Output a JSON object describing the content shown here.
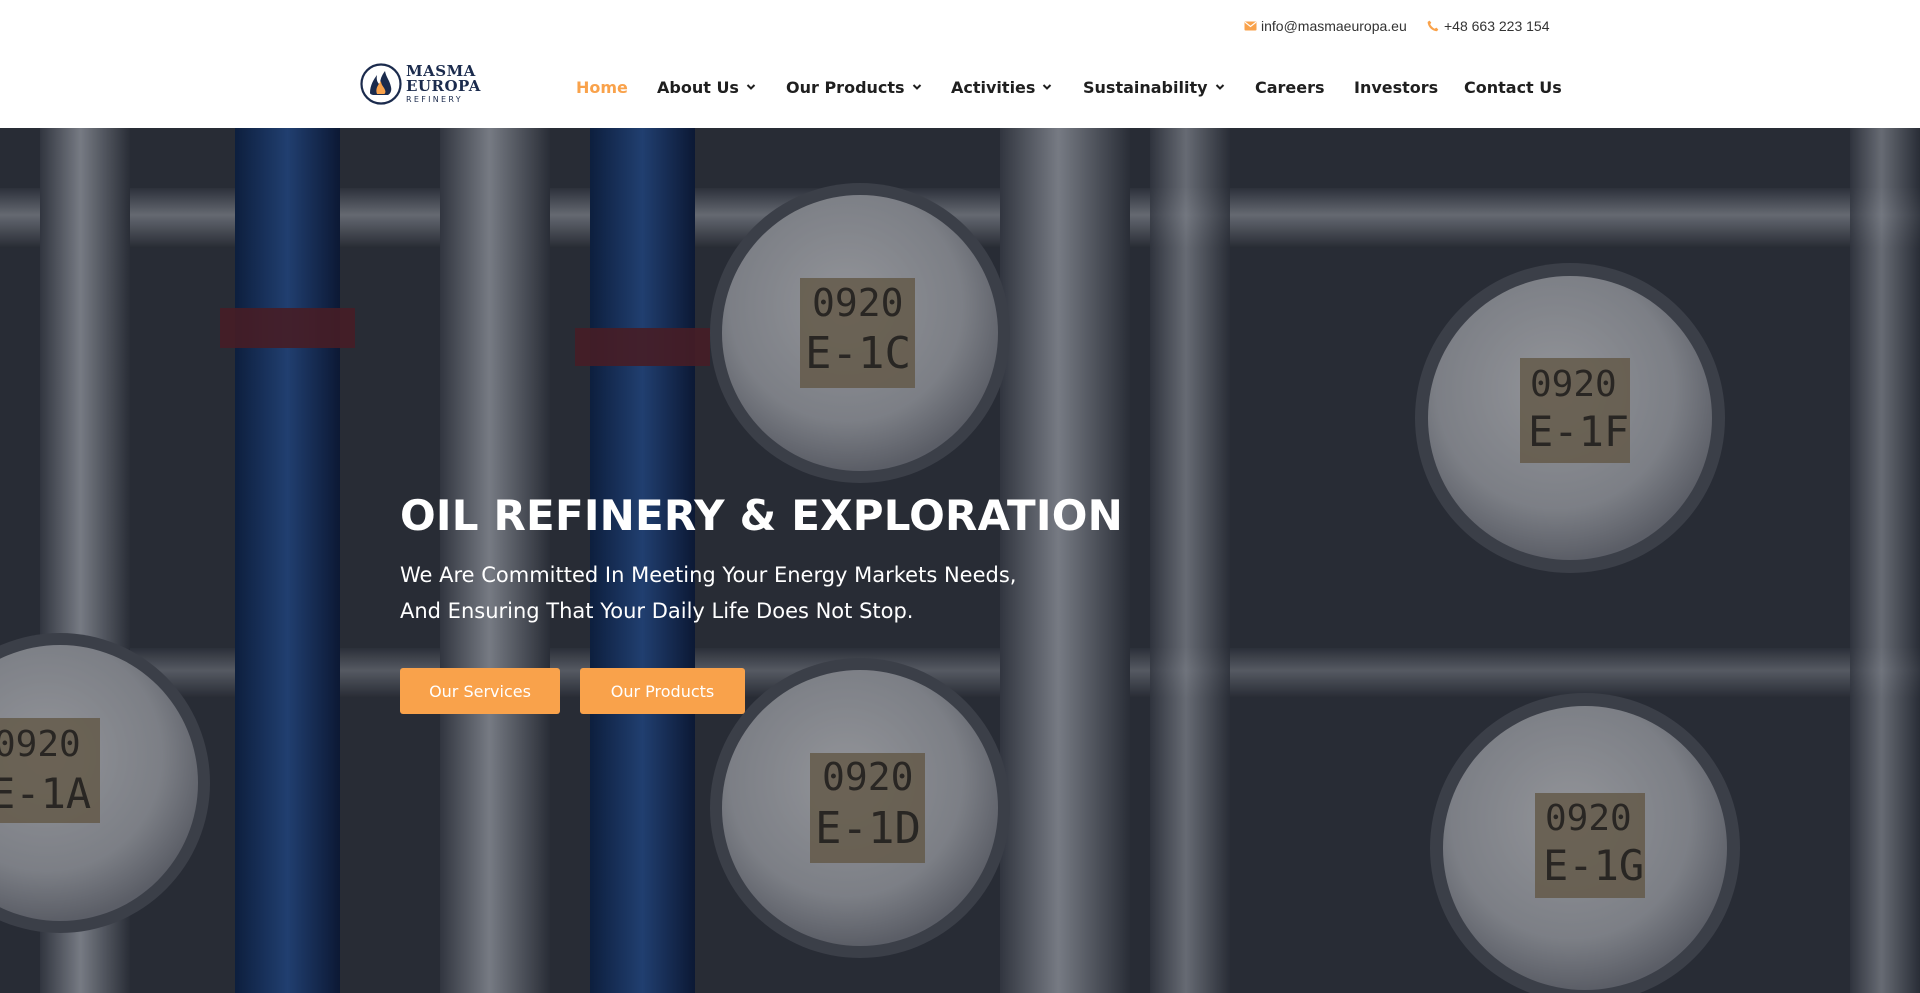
{
  "topbar": {
    "email": "info@masmaeuropa.eu",
    "phone": "+48 663 223 154",
    "email_icon": "envelope-icon",
    "phone_icon": "phone-icon"
  },
  "logo": {
    "line1": "MASMA",
    "line2": "EUROPA",
    "line3": "REFINERY"
  },
  "nav": {
    "items": [
      {
        "label": "Home",
        "active": true
      },
      {
        "label": "About Us",
        "dropdown": true
      },
      {
        "label": "Our Products",
        "dropdown": true
      },
      {
        "label": "Activities",
        "dropdown": true
      },
      {
        "label": "Sustainability",
        "dropdown": true
      },
      {
        "label": "Careers"
      },
      {
        "label": "Investors"
      },
      {
        "label": "Contact Us"
      }
    ]
  },
  "hero": {
    "title": "OIL REFINERY & EXPLORATION",
    "subtitle": "We Are Committed In Meeting Your Energy Markets Needs, And Ensuring That Your Daily Life Does Not Stop.",
    "buttons": {
      "services": "Our Services",
      "products": "Our Products"
    },
    "tags": [
      "0920",
      "E-1C",
      "E-1F",
      "E-1A",
      "E-1D",
      "E-1G"
    ]
  },
  "colors": {
    "accent": "#f9a24b",
    "brand": "#1b2b4d",
    "text": "#1f1f1f"
  }
}
